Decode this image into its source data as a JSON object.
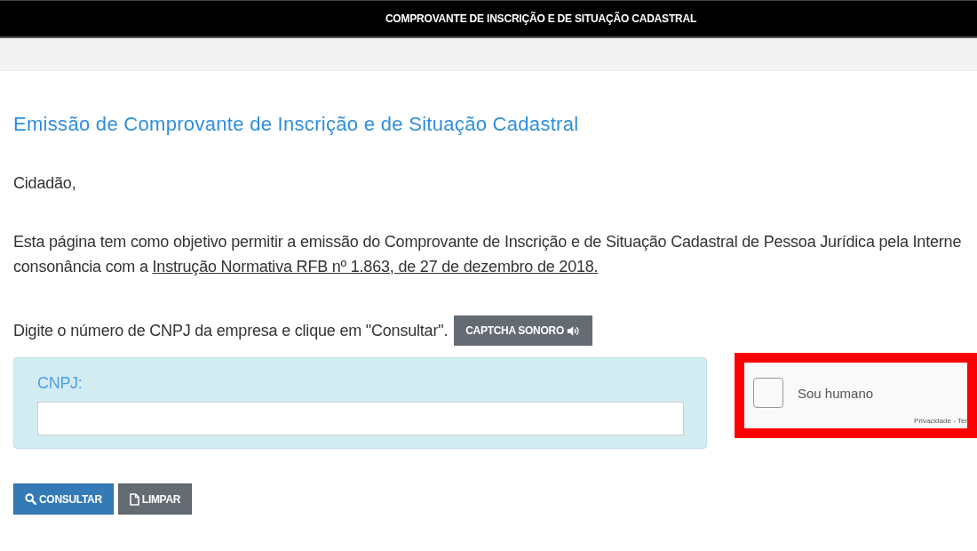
{
  "header": {
    "title": "COMPROVANTE DE INSCRIÇÃO E DE SITUAÇÃO CADASTRAL"
  },
  "content": {
    "heading": "Emissão de Comprovante de Inscrição e de Situação Cadastral",
    "greeting": "Cidadão,",
    "intro": {
      "text": "Esta página tem como objetivo permitir a emissão do Comprovante de Inscrição e de Situação Cadastral de Pessoa Jurídica pela Interne",
      "continuation": "consonância com a",
      "link": "Instrução Normativa RFB nº 1.863, de 27 de dezembro de 2018."
    },
    "instruction": "Digite o número de CNPJ da empresa e clique em \"Consultar\".",
    "audio_button": {
      "label": "CAPTCHA SONORO"
    }
  },
  "cnpj_form": {
    "label": "CNPJ:"
  },
  "captcha": {
    "highlighted": true,
    "checked": false,
    "label": "Sou humano",
    "footer": "Privacidade - Ter"
  },
  "buttons": [
    {
      "kind": "search",
      "label": "CONSULTAR"
    },
    {
      "kind": "clear",
      "label": "LIMPAR"
    }
  ]
}
